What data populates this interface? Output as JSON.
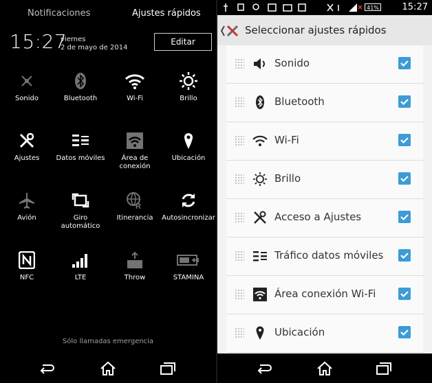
{
  "left": {
    "tabs": {
      "notifications": "Notificaciones",
      "quick_settings": "Ajustes rápidos"
    },
    "clock": "15:27",
    "day": "viernes",
    "date": "2 de mayo de 2014",
    "edit_label": "Editar",
    "tiles": [
      {
        "label": "Sonido",
        "icon": "sound-off-icon",
        "active": false
      },
      {
        "label": "Bluetooth",
        "icon": "bluetooth-icon",
        "active": false
      },
      {
        "label": "Wi-Fi",
        "icon": "wifi-icon",
        "active": true
      },
      {
        "label": "Brillo",
        "icon": "brightness-icon",
        "active": true
      },
      {
        "label": "Ajustes",
        "icon": "settings-tools-icon",
        "active": true
      },
      {
        "label": "Datos móviles",
        "icon": "mobile-data-icon",
        "active": true
      },
      {
        "label": "Área de conexión",
        "icon": "hotspot-icon",
        "active": false
      },
      {
        "label": "Ubicación",
        "icon": "location-icon",
        "active": true
      },
      {
        "label": "Avión",
        "icon": "airplane-icon",
        "active": false
      },
      {
        "label": "Giro automático",
        "icon": "auto-rotate-icon",
        "active": true
      },
      {
        "label": "Itinerancia",
        "icon": "roaming-icon",
        "active": false
      },
      {
        "label": "Autosincronizar",
        "icon": "sync-icon",
        "active": true
      },
      {
        "label": "NFC",
        "icon": "nfc-icon",
        "active": true
      },
      {
        "label": "LTE",
        "icon": "signal-lte-icon",
        "active": true
      },
      {
        "label": "Throw",
        "icon": "throw-icon",
        "active": false
      },
      {
        "label": "STAMINA",
        "icon": "stamina-battery-icon",
        "active": false
      }
    ],
    "emergency": "Sólo llamadas emergencia"
  },
  "right": {
    "time": "15:27",
    "battery": "41%",
    "title": "Seleccionar ajustes rápidos",
    "items": [
      {
        "label": "Sonido",
        "icon": "speaker-icon",
        "checked": true
      },
      {
        "label": "Bluetooth",
        "icon": "bluetooth-icon",
        "checked": true
      },
      {
        "label": "Wi-Fi",
        "icon": "wifi-icon",
        "checked": true
      },
      {
        "label": "Brillo",
        "icon": "brightness-icon",
        "checked": true
      },
      {
        "label": "Acceso a Ajustes",
        "icon": "settings-tools-icon",
        "checked": true
      },
      {
        "label": "Tráfico datos móviles",
        "icon": "mobile-data-icon",
        "checked": true
      },
      {
        "label": "Área conexión Wi-Fi",
        "icon": "hotspot-icon",
        "checked": true
      },
      {
        "label": "Ubicación",
        "icon": "location-icon",
        "checked": true
      }
    ]
  },
  "colors": {
    "accent": "#3d9bd6",
    "left_bg": "#000000",
    "right_bg": "#f2f2f2"
  }
}
